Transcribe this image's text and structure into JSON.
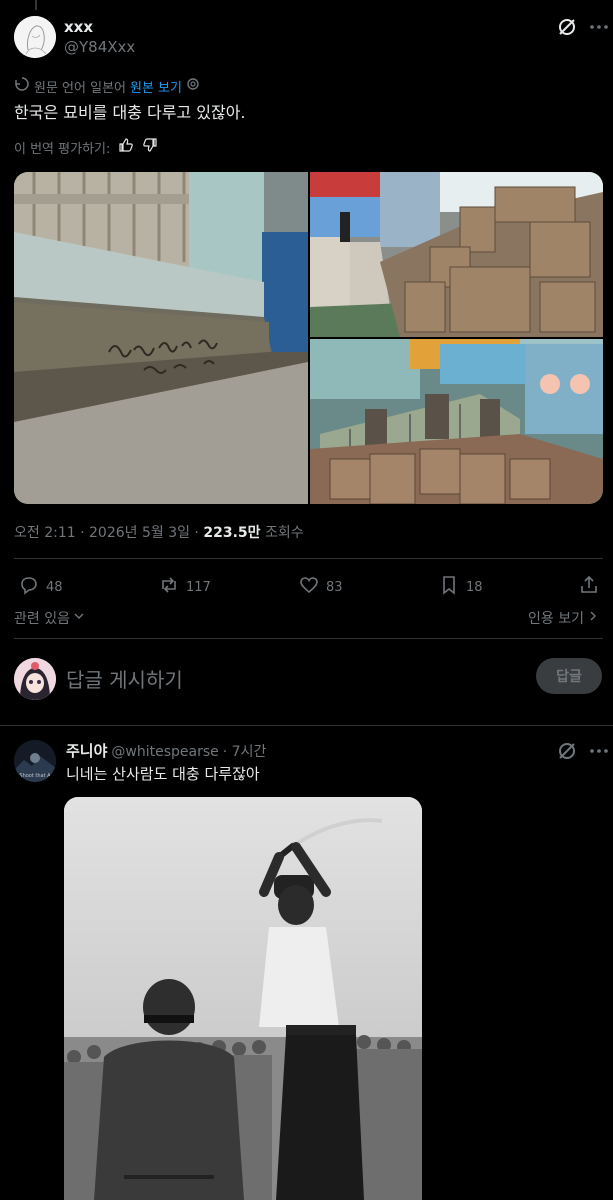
{
  "tweet": {
    "display_name": "xxx",
    "handle": "@Y84Xxx",
    "translate_prefix": "원문 언어 일본어",
    "translate_link": "원본 보기",
    "text": "한국은 묘비를 대충 다루고 있잖아.",
    "rate_translation": "이 번역 평가하기:",
    "time": "오전 2:11 · 2026년 5월 3일 · ",
    "views_count": "223.5만",
    "views_label": " 조회수",
    "actions": {
      "replies": "48",
      "retweets": "117",
      "likes": "83",
      "bookmarks": "18"
    },
    "related": "관련 있음",
    "quotes": "인용 보기"
  },
  "reply_box": {
    "placeholder": "답글 게시하기",
    "button": "답글"
  },
  "reply": {
    "name": "주니야",
    "handle": "@whitespearse",
    "time": "· 7시간",
    "text": "니네는 산사람도 대충 다루잖아",
    "avatar_text": "Shoot that A"
  },
  "colors": {
    "accent": "#1d9bf0",
    "muted": "#71767b",
    "text": "#e7e9ea",
    "divider": "#2f3336"
  }
}
